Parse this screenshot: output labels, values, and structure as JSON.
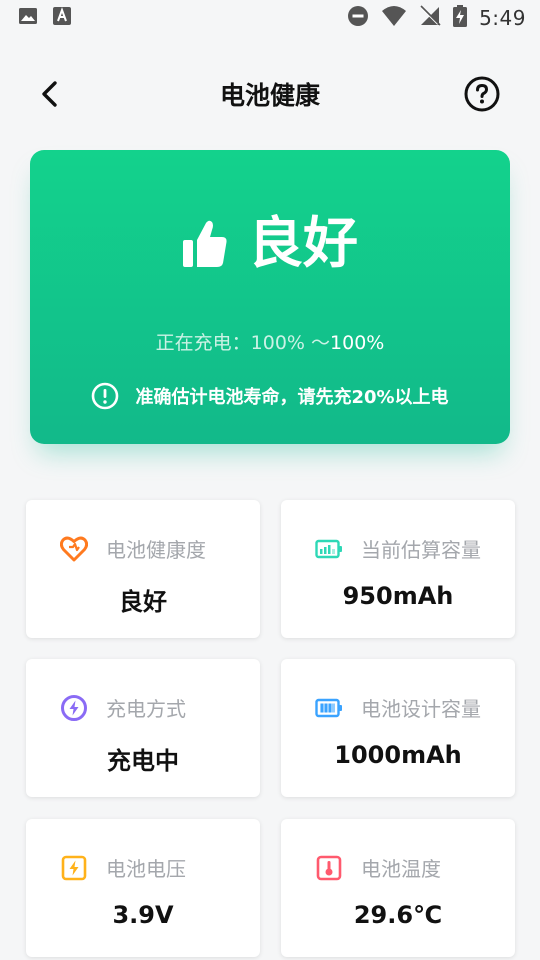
{
  "statusbar": {
    "time": "5:49"
  },
  "header": {
    "title": "电池健康"
  },
  "hero": {
    "status": "良好",
    "charge_prefix": "正在充电：100% ～",
    "charge_value": "100%",
    "tip": "准确估计电池寿命，请先充20%以上电"
  },
  "cards": [
    {
      "label": "电池健康度",
      "value": "良好",
      "icon": "heart-icon",
      "color": "#ff7a1f"
    },
    {
      "label": "当前估算容量",
      "value": "950mAh",
      "icon": "battery-level-icon",
      "color": "#2ed8b6"
    },
    {
      "label": "充电方式",
      "value": "充电中",
      "icon": "charging-bolt-icon",
      "color": "#8a6bf5"
    },
    {
      "label": "电池设计容量",
      "value": "1000mAh",
      "icon": "battery-design-icon",
      "color": "#3aa3ff"
    },
    {
      "label": "电池电压",
      "value": "3.9V",
      "icon": "voltage-icon",
      "color": "#ffb21a"
    },
    {
      "label": "电池温度",
      "value": "29.6℃",
      "icon": "thermometer-icon",
      "color": "#ff5a6e"
    }
  ],
  "colors": {
    "accent": "#13d28c",
    "accent_dark": "#12b98a"
  }
}
